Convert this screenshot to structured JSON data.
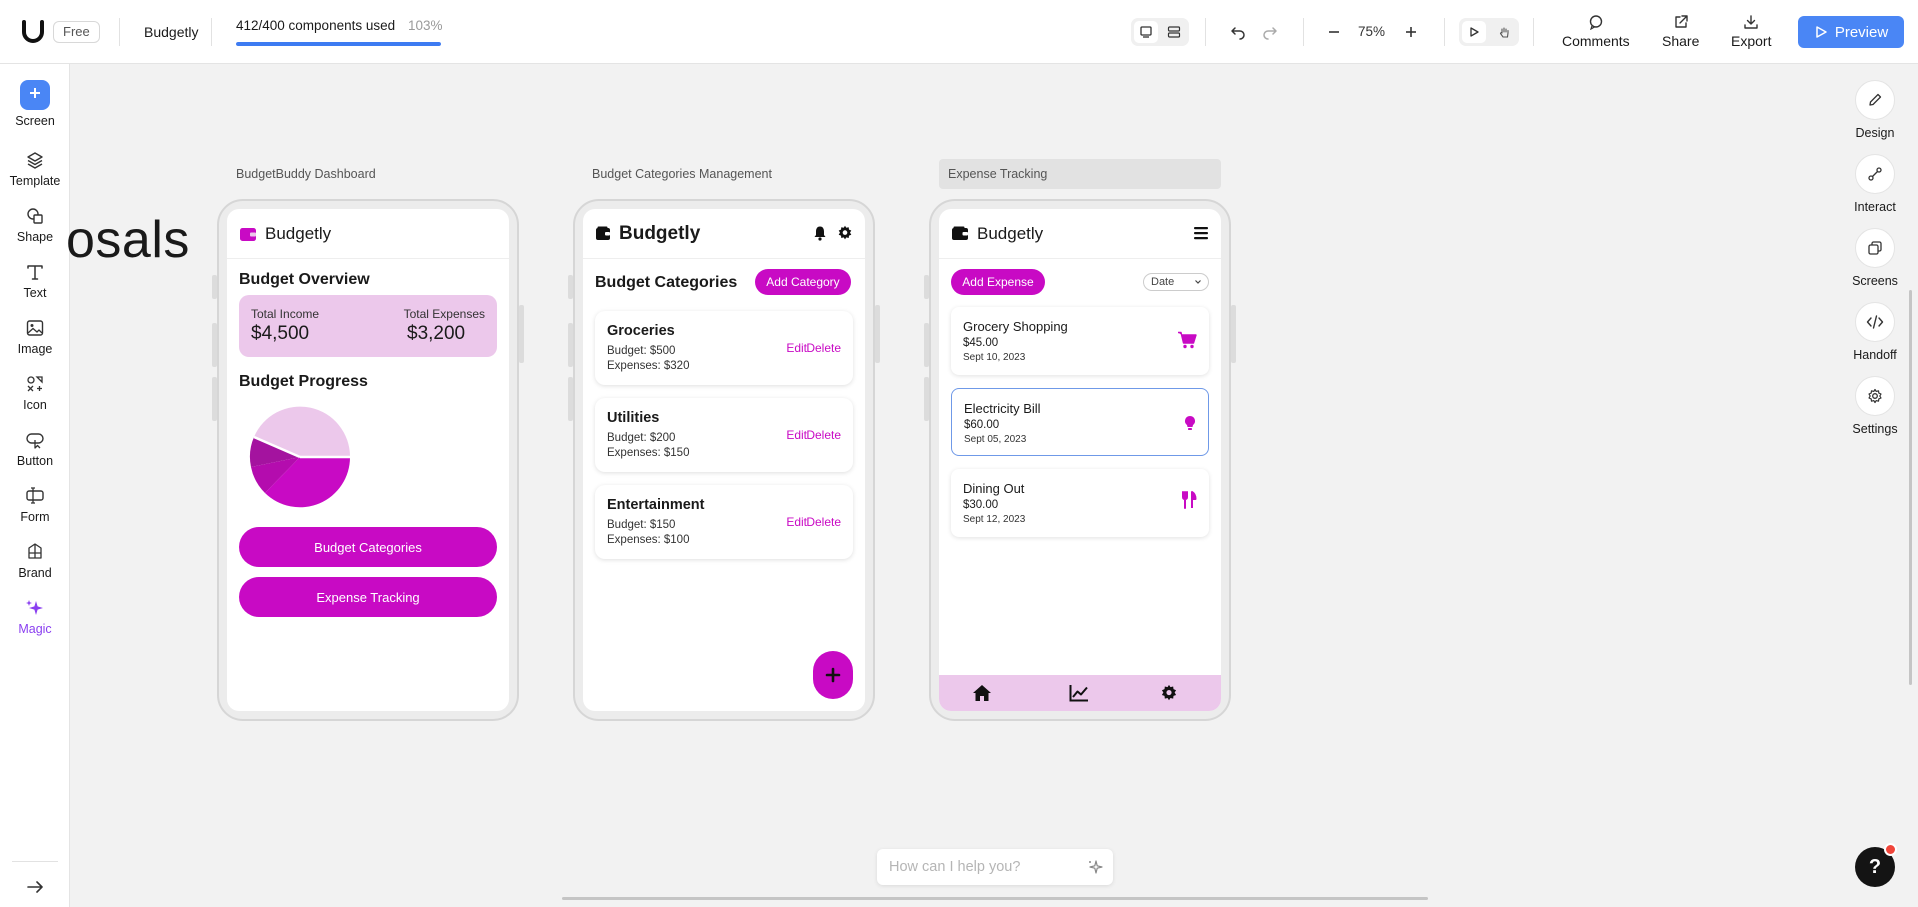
{
  "topbar": {
    "plan_badge": "Free",
    "project_name": "Budgetly",
    "usage_text": "412/400 components used",
    "usage_percent": "103%",
    "usage_fill": 1.0,
    "zoom": "75%",
    "comments": "Comments",
    "share": "Share",
    "export": "Export",
    "preview": "Preview"
  },
  "left_tools": [
    {
      "label": "Screen",
      "icon": "plus-icon"
    },
    {
      "label": "Template",
      "icon": "layers-icon"
    },
    {
      "label": "Shape",
      "icon": "shapes-icon"
    },
    {
      "label": "Text",
      "icon": "text-icon"
    },
    {
      "label": "Image",
      "icon": "image-icon"
    },
    {
      "label": "Icon",
      "icon": "icons-icon"
    },
    {
      "label": "Button",
      "icon": "button-icon"
    },
    {
      "label": "Form",
      "icon": "form-icon"
    },
    {
      "label": "Brand",
      "icon": "brand-icon"
    },
    {
      "label": "Magic",
      "icon": "sparkle-icon"
    }
  ],
  "right_tools": [
    {
      "label": "Design",
      "icon": "pencil-icon"
    },
    {
      "label": "Interact",
      "icon": "link-icon"
    },
    {
      "label": "Screens",
      "icon": "copy-icon"
    },
    {
      "label": "Handoff",
      "icon": "code-icon"
    },
    {
      "label": "Settings",
      "icon": "gear-icon"
    }
  ],
  "canvas": {
    "background_text": "osals",
    "frames": [
      {
        "label": "BudgetBuddy Dashboard",
        "app_name": "Budgetly",
        "overview_title": "Budget Overview",
        "income_label": "Total Income",
        "income_value": "$4,500",
        "expenses_label": "Total Expenses",
        "expenses_value": "$3,200",
        "progress_title": "Budget Progress",
        "buttons": [
          "Budget Categories",
          "Expense Tracking"
        ]
      },
      {
        "label": "Budget Categories Management",
        "app_name": "Budgetly",
        "section_title": "Budget Categories",
        "add_button": "Add Category",
        "categories": [
          {
            "name": "Groceries",
            "budget": "Budget: $500",
            "expenses": "Expenses: $320",
            "edit": "Edit",
            "delete": "Delete"
          },
          {
            "name": "Utilities",
            "budget": "Budget: $200",
            "expenses": "Expenses: $150",
            "edit": "Edit",
            "delete": "Delete"
          },
          {
            "name": "Entertainment",
            "budget": "Budget: $150",
            "expenses": "Expenses: $100",
            "edit": "Edit",
            "delete": "Delete"
          }
        ]
      },
      {
        "label": "Expense Tracking",
        "app_name": "Budgetly",
        "add_button": "Add Expense",
        "sort_select": "Date",
        "expenses": [
          {
            "name": "Grocery Shopping",
            "amount": "$45.00",
            "date": "Sept 10, 2023",
            "icon": "cart-icon"
          },
          {
            "name": "Electricity Bill",
            "amount": "$60.00",
            "date": "Sept 05, 2023",
            "icon": "lightbulb-icon"
          },
          {
            "name": "Dining Out",
            "amount": "$30.00",
            "date": "Sept 12, 2023",
            "icon": "utensils-icon"
          }
        ]
      }
    ]
  },
  "chat": {
    "placeholder": "How can I help you?"
  },
  "colors": {
    "accent": "#c80ac4",
    "accent_light": "#ecc8eb",
    "primary_blue": "#4a86f5"
  }
}
